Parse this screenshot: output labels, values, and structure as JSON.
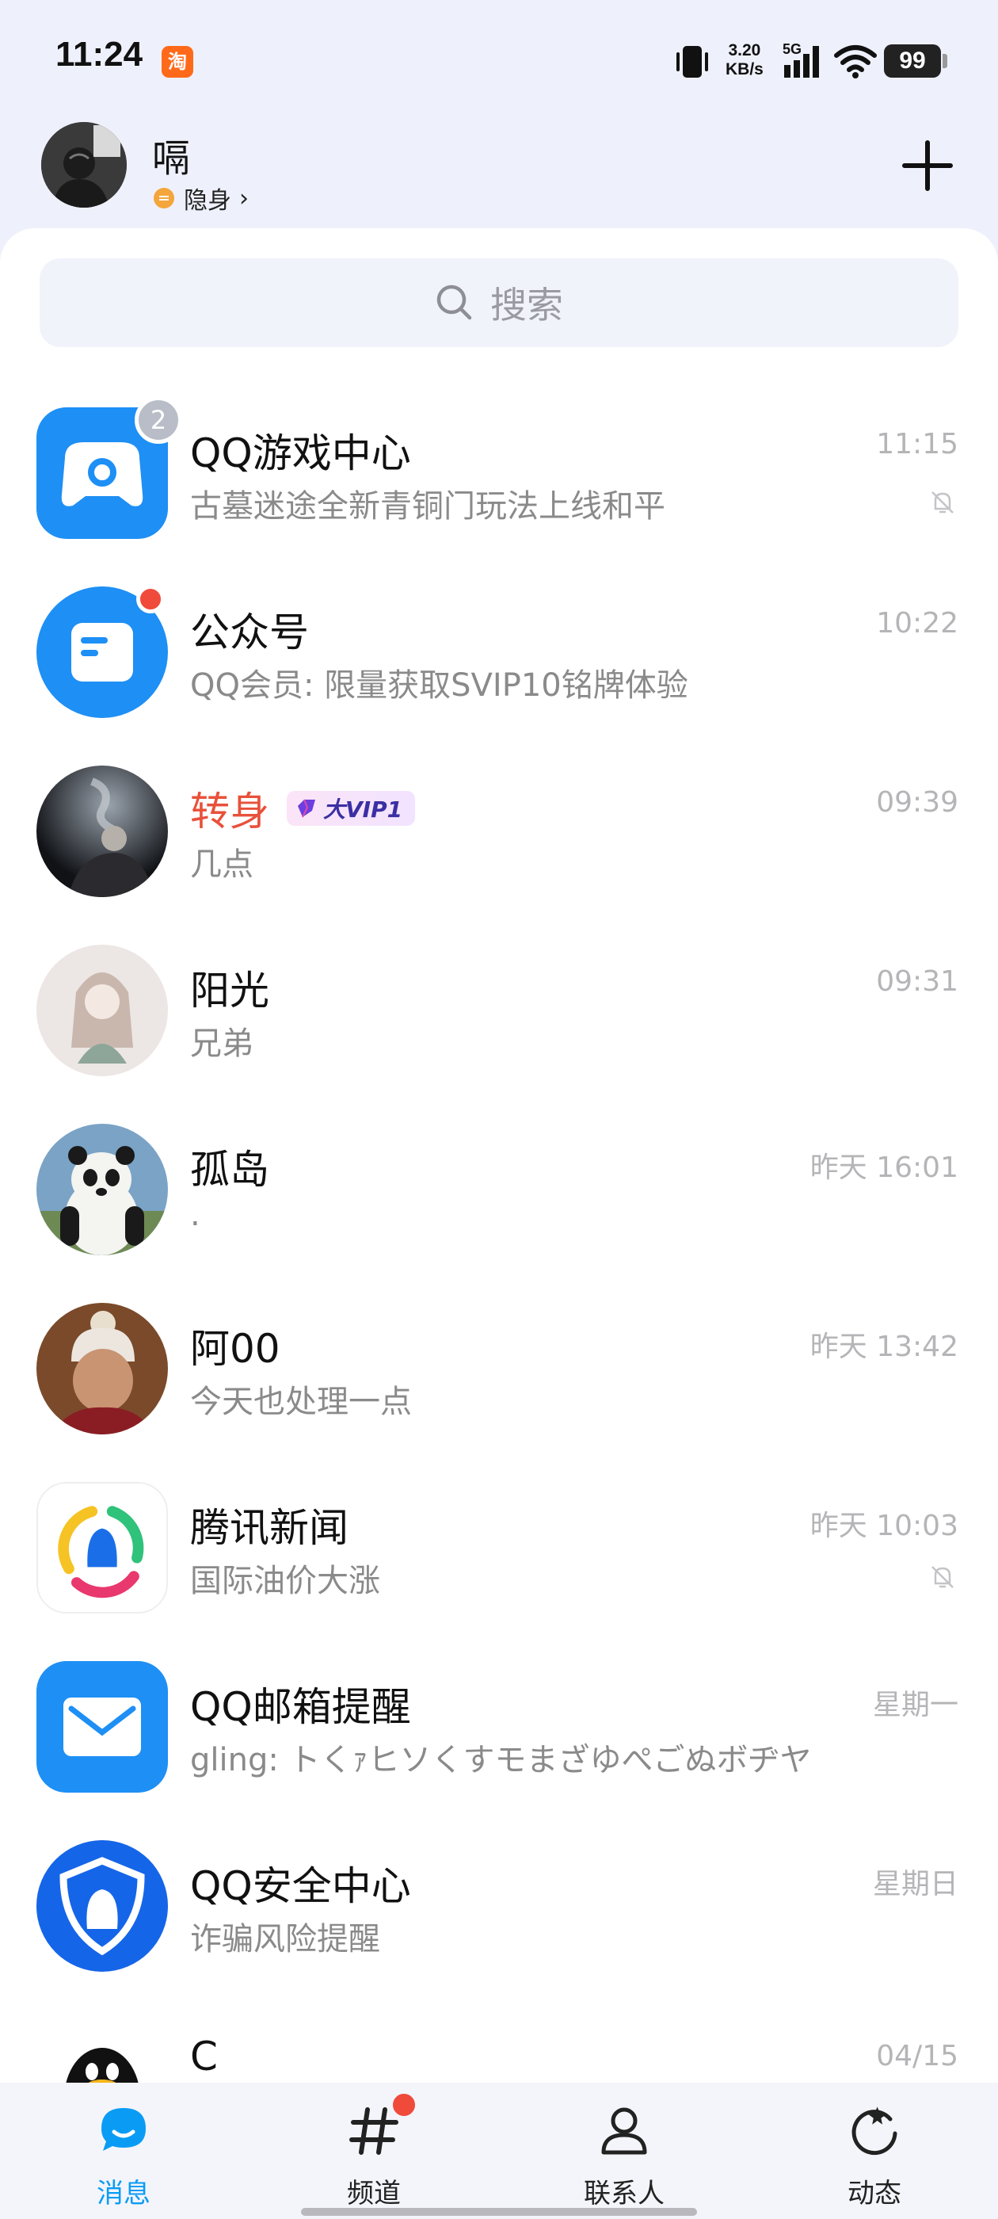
{
  "status_bar": {
    "time": "11:24",
    "taobao_glyph": "淘",
    "net_speed_value": "3.20",
    "net_speed_unit": "KB/s",
    "network_type": "5G",
    "battery": "99"
  },
  "profile": {
    "name": "嗝",
    "status": "隐身",
    "status_chevron": "›"
  },
  "search": {
    "placeholder": "搜索"
  },
  "chats": [
    {
      "title": "QQ游戏中心",
      "preview": "古墓迷途全新青铜门玩法上线和平",
      "time": "11:15",
      "badge": "2",
      "muted": true
    },
    {
      "title": "公众号",
      "preview": "QQ会员: 限量获取SVIP10铭牌体验",
      "time": "10:22",
      "unread_dot": true
    },
    {
      "title": "转身",
      "preview": " 几点",
      "time": "09:39",
      "vip_label": "大VIP1"
    },
    {
      "title": "阳光",
      "preview": "兄弟",
      "time": "09:31"
    },
    {
      "title": "孤岛",
      "preview": ".",
      "time": "昨天 16:01"
    },
    {
      "title": "阿00",
      "preview": "今天也处理一点",
      "time": "昨天 13:42"
    },
    {
      "title": "腾讯新闻",
      "preview": "国际油价大涨",
      "time": "昨天 10:03",
      "muted": true
    },
    {
      "title": "QQ邮箱提醒",
      "preview": "gling: トくｧヒソくすモまざゆぺごぬボヂヤ",
      "time": "星期一"
    },
    {
      "title": "QQ安全中心",
      "preview": "诈骗风险提醒",
      "time": "星期日"
    },
    {
      "title": "C",
      "preview": "",
      "time": "04/15"
    }
  ],
  "nav": {
    "messages": "消息",
    "channels": "频道",
    "contacts": "联系人",
    "moments": "动态"
  },
  "colors": {
    "accent": "#0a9cf5",
    "unread_red": "#f04a3b",
    "vip_name": "#e8513a",
    "qq_blue": "#1e8ff5"
  }
}
